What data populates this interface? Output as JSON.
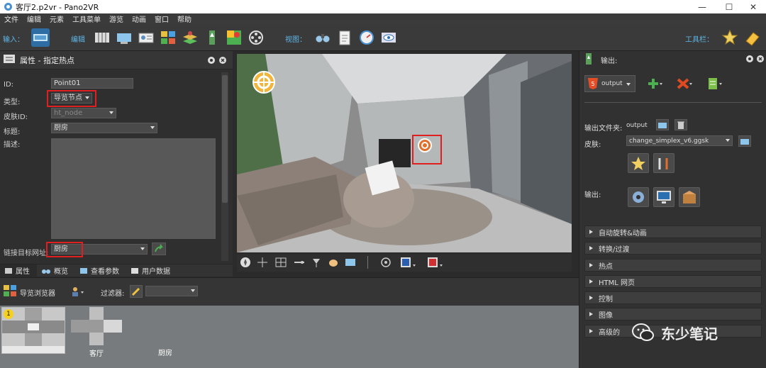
{
  "window": {
    "title": "客厅2.p2vr - Pano2VR",
    "controls": [
      "—",
      "☐",
      "✕"
    ]
  },
  "menu": [
    "文件",
    "编辑",
    "元素",
    "工具菜单",
    "游览",
    "动画",
    "窗口",
    "帮助"
  ],
  "toolbar": {
    "input_label": "输入：",
    "edit_label": "编辑",
    "view_label": "视图：",
    "tools_label": "工具栏："
  },
  "properties": {
    "title": "属性 - 指定热点",
    "id_label": "ID:",
    "id_value": "Point01",
    "type_label": "类型:",
    "type_value": "导览节点",
    "skin_id_label": "皮肤ID:",
    "skin_id_value": "ht_node",
    "caption_label": "标题:",
    "caption_value": "厨房",
    "desc_label": "描述:",
    "link_label": "链接目标网址:",
    "link_value": "厨房"
  },
  "left_tabs": [
    "属性",
    "概览",
    "查看参数",
    "用户数据"
  ],
  "tour_browser": {
    "title": "导览浏览器",
    "filter_label": "过滤器:",
    "nodes": [
      {
        "label": "客厅",
        "badge": "1"
      },
      {
        "label": "厨房"
      }
    ]
  },
  "output_panel": {
    "title": "输出:",
    "format": "output",
    "folder_label": "输出文件夹:",
    "folder_value": "output",
    "skin_label": "皮肤:",
    "skin_value": "change_simplex_v6.ggsk",
    "output_label": "输出:",
    "sections": [
      "自动旋转&动画",
      "转换/过渡",
      "热点",
      "HTML 网页",
      "控制",
      "图像",
      "高级的"
    ]
  },
  "watermark": "东少笔记",
  "colors": {
    "highlight": "#e02020",
    "accent_blue": "#5fb6e8"
  }
}
